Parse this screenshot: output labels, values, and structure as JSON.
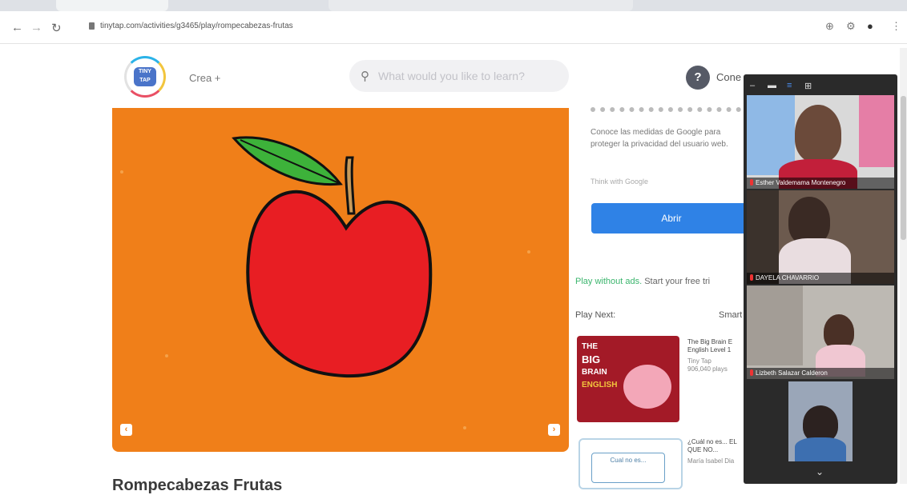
{
  "browser": {
    "url": "tinytap.com/activities/g3465/play/rompecabezas-frutas",
    "back_icon": "back-arrow-icon",
    "forward_icon": "forward-arrow-icon",
    "reload_icon": "reload-icon"
  },
  "header": {
    "logo_text": "TINY TAP",
    "create_label": "Crea +",
    "search_placeholder": "What would you like to learn?",
    "help_label": "Cone"
  },
  "game": {
    "prev_symbol": "‹",
    "next_symbol": "›",
    "background_color": "#f07f19"
  },
  "page_title": "Rompecabezas Frutas",
  "ad": {
    "text": "Conoce las medidas de Google para proteger la privacidad del usuario web.",
    "by_google": "Think with Google",
    "button": "Abrir"
  },
  "promo": {
    "play_without_ads": "Play without ads.",
    "free_trial": " Start your free tri"
  },
  "play_next": {
    "label": "Play Next:",
    "smart_label": "Smart",
    "items": [
      {
        "title": "The Big Brain E English Level 1",
        "author": "Tiny Tap",
        "plays": "906,040 plays",
        "thumb_lines": [
          "THE",
          "BIG",
          "BRAIN",
          "ENGLISH"
        ]
      },
      {
        "title": "¿Cuál no es... EL QUE NO...",
        "author": "María Isabel Dia",
        "plays": "",
        "thumb_text": "Cual no es..."
      }
    ]
  },
  "video_call": {
    "participants": [
      {
        "name": "Esther Valdemama Montenegro"
      },
      {
        "name": "DAYELA CHAVARRIO"
      },
      {
        "name": "Lizbeth Salazar Calderon"
      },
      {
        "name": ""
      }
    ]
  }
}
